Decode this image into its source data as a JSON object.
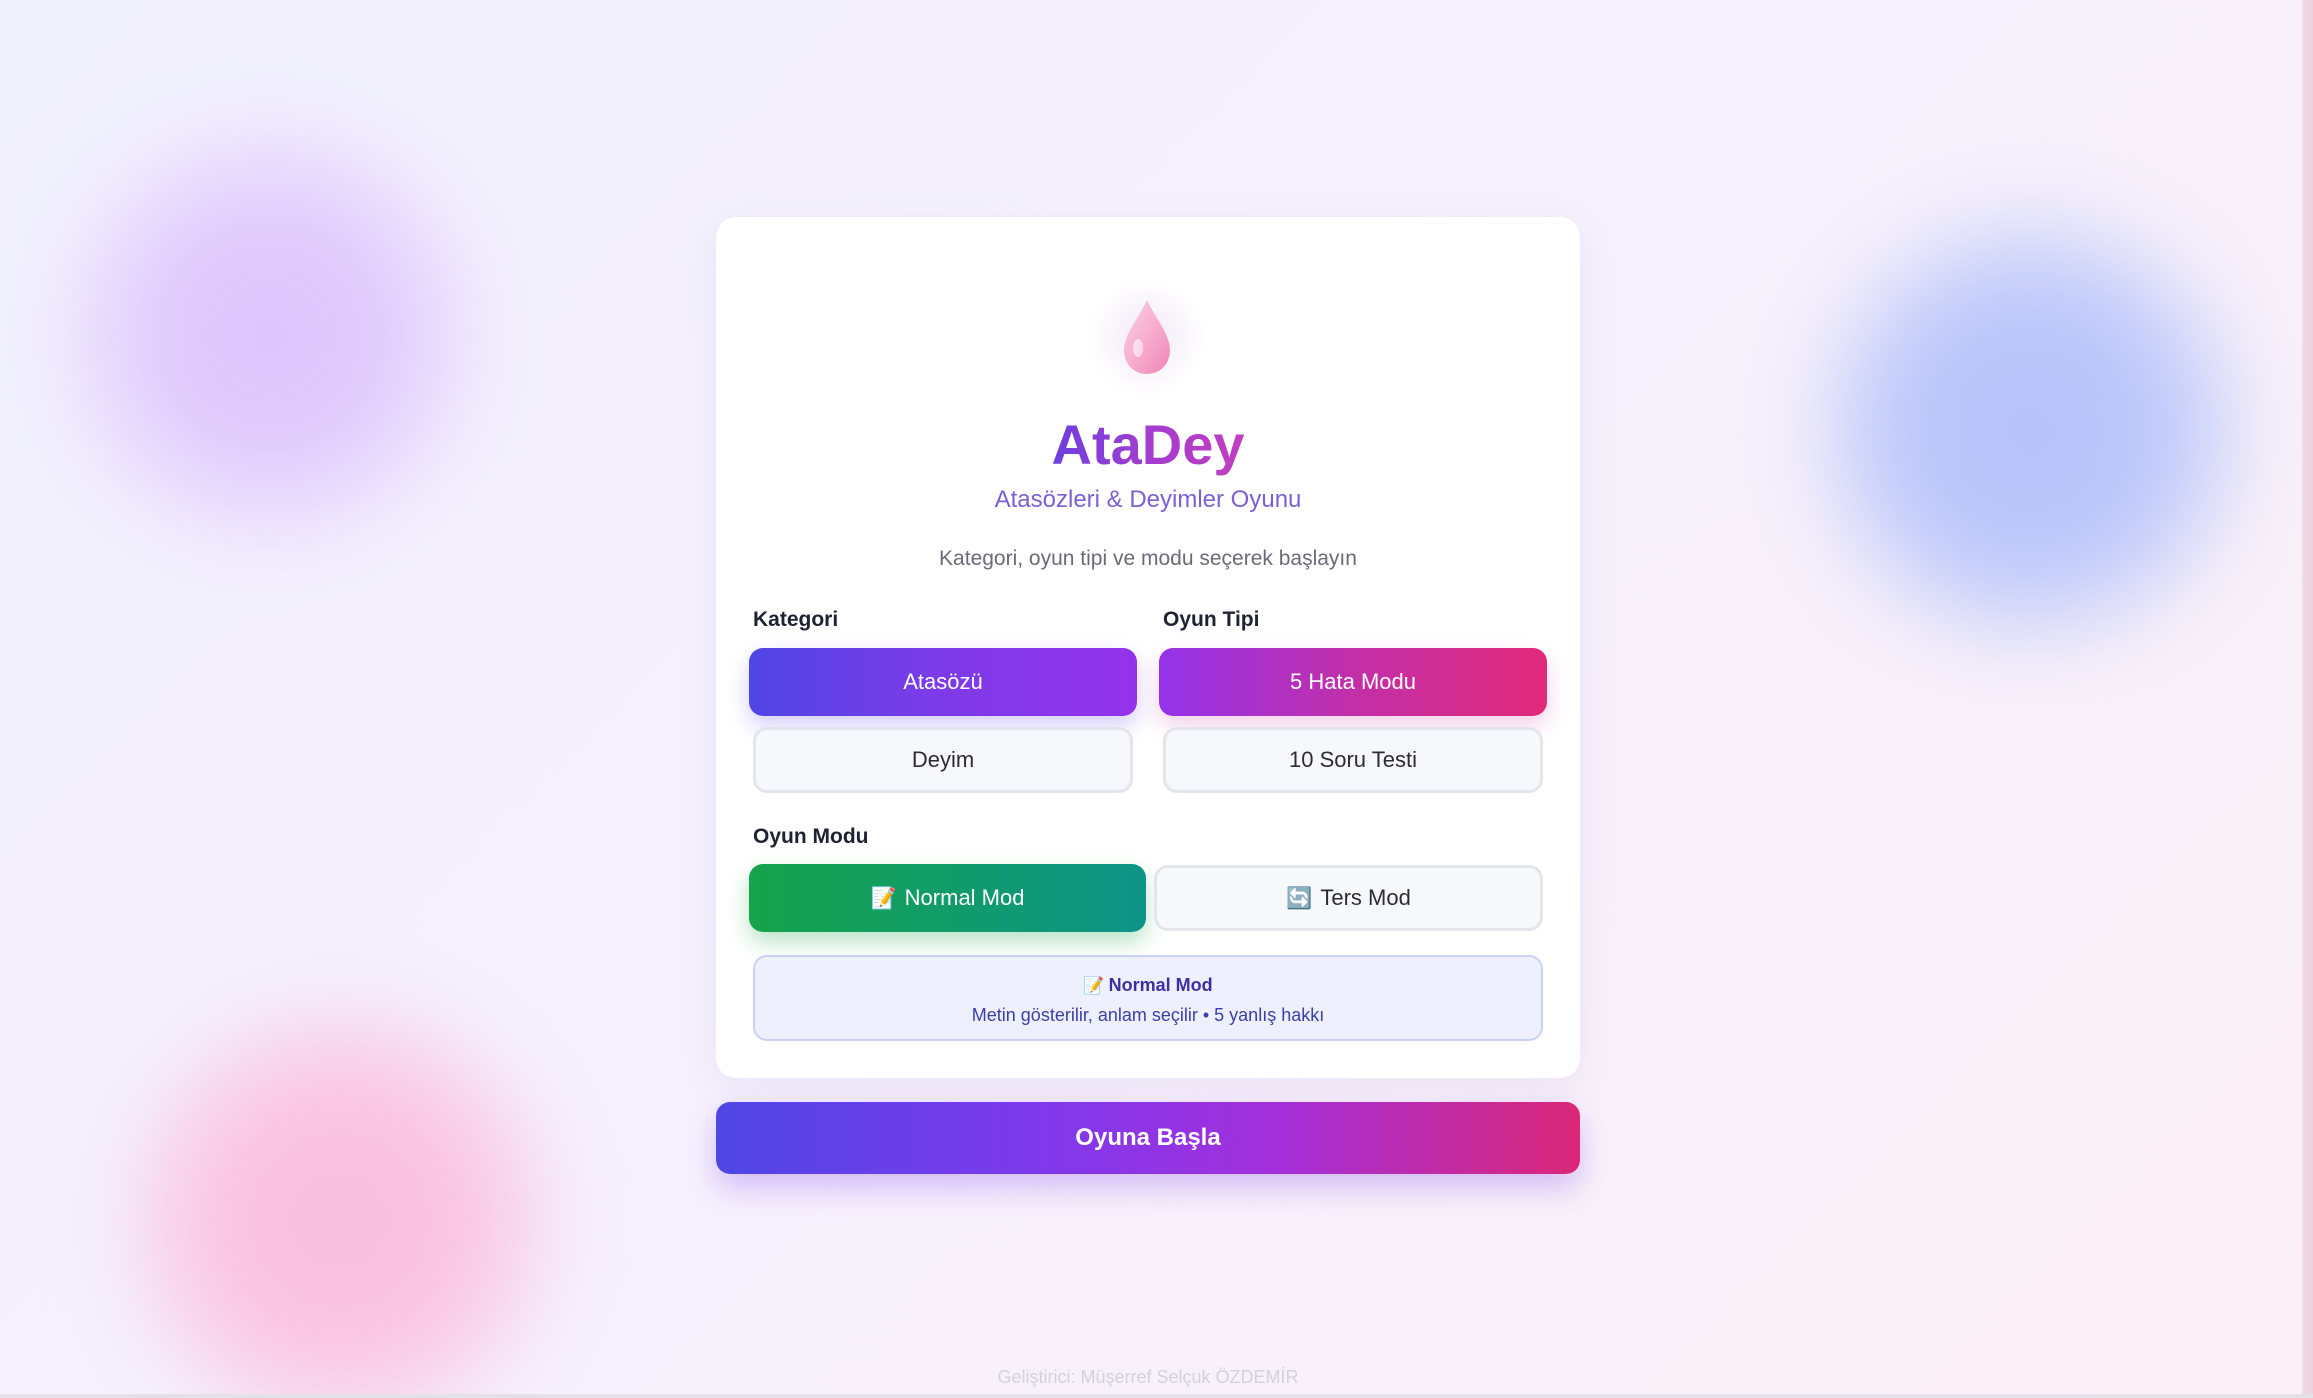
{
  "app": {
    "title": "AtaDey",
    "subtitle": "Atasözleri & Deyimler Oyunu",
    "instruction": "Kategori, oyun tipi ve modu seçerek başlayın",
    "logo_icon": "droplet-icon"
  },
  "category": {
    "label": "Kategori",
    "options": [
      {
        "label": "Atasözü",
        "selected": true
      },
      {
        "label": "Deyim",
        "selected": false
      }
    ]
  },
  "game_type": {
    "label": "Oyun Tipi",
    "options": [
      {
        "label": "5 Hata Modu",
        "selected": true
      },
      {
        "label": "10 Soru Testi",
        "selected": false
      }
    ]
  },
  "game_mode": {
    "label": "Oyun Modu",
    "options": [
      {
        "icon": "📝",
        "icon_name": "memo-icon",
        "label": "Normal Mod",
        "selected": true
      },
      {
        "icon": "🔄",
        "icon_name": "refresh-icon",
        "label": "Ters Mod",
        "selected": false
      }
    ]
  },
  "mode_info": {
    "icon": "📝",
    "title": "Normal Mod",
    "description": "Metin gösterilir, anlam seçilir • 5 yanlış hakkı"
  },
  "start_button": {
    "label": "Oyuna Başla"
  },
  "footer": {
    "text": "Geliştirici: Müşerref Selçuk ÖZDEMİR"
  },
  "colors": {
    "indigo": "#4f46e5",
    "purple": "#9333ea",
    "magenta": "#db2777",
    "green": "#16a34a",
    "teal": "#0d9488"
  }
}
